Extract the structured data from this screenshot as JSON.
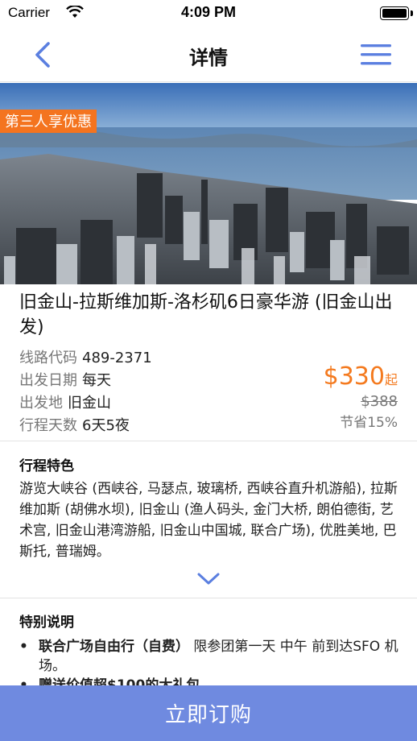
{
  "status_bar": {
    "carrier": "Carrier",
    "time": "4:09 PM"
  },
  "nav": {
    "title": "详情",
    "back_icon": "chevron-left-icon",
    "menu_icon": "hamburger-menu-icon",
    "accent_color": "#5b7fe0"
  },
  "hero": {
    "badge": "第三人享优惠",
    "badge_color": "#f4741f"
  },
  "tour": {
    "title": "旧金山-拉斯维加斯-洛杉矶6日豪华游 (旧金山出发)",
    "info": [
      {
        "label": "线路代码",
        "value": "489-2371"
      },
      {
        "label": "出发日期",
        "value": "每天"
      },
      {
        "label": "出发地",
        "value": "旧金山"
      },
      {
        "label": "行程天数",
        "value": "6天5夜"
      }
    ],
    "price": "$330",
    "price_suffix": "起",
    "original_price": "$388",
    "saving": "节省15%",
    "price_color": "#f47a1f"
  },
  "features": {
    "heading": "行程特色",
    "text": "游览大峡谷 (西峡谷, 马瑟点, 玻璃桥, 西峡谷直升机游船), 拉斯维加斯 (胡佛水坝), 旧金山 (渔人码头, 金门大桥, 朗伯德街, 艺术宫, 旧金山港湾游船, 旧金山中国城, 联合广场), 优胜美地, 巴斯托, 普瑞姆。",
    "expand_icon": "chevron-down-icon"
  },
  "notes": {
    "heading": "特别说明",
    "items": [
      {
        "bold": "联合广场自由行（自费）",
        "text": " 限参团第一天 中午 前到达SFO 机场。"
      },
      {
        "bold": "赠送价值超$100的大礼包",
        "text": ""
      }
    ]
  },
  "cta": {
    "label": "立即订购",
    "color": "#6f8ae0"
  }
}
